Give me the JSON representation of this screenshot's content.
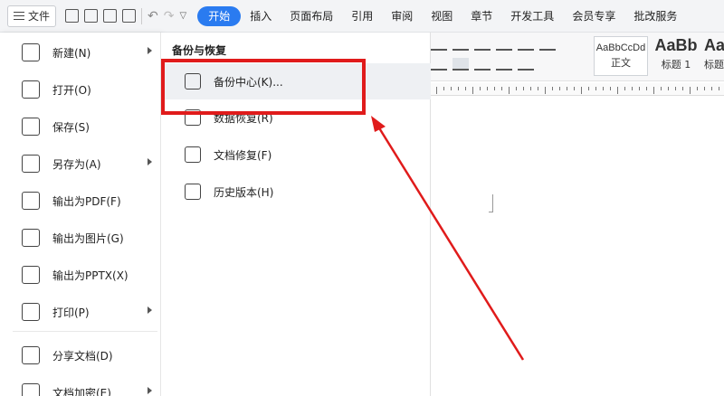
{
  "topbar": {
    "menu_label": "文件",
    "tabs": [
      "开始",
      "插入",
      "页面布局",
      "引用",
      "审阅",
      "视图",
      "章节",
      "开发工具",
      "会员专享",
      "批改服务"
    ],
    "active_tab": "开始"
  },
  "ribbon": {
    "styles": [
      {
        "sample": "AaBbCcDd",
        "label": "正文"
      },
      {
        "sample": "AaBb",
        "label": "标题 1"
      },
      {
        "sample": "AaE",
        "label": "标题"
      }
    ]
  },
  "file_menu": {
    "items": [
      {
        "label": "新建(N)",
        "icon": "new-doc-icon",
        "arrow": true
      },
      {
        "label": "打开(O)",
        "icon": "folder-open-icon",
        "arrow": false
      },
      {
        "label": "保存(S)",
        "icon": "save-icon",
        "arrow": false
      },
      {
        "label": "另存为(A)",
        "icon": "save-as-icon",
        "arrow": true
      },
      {
        "label": "输出为PDF(F)",
        "icon": "pdf-icon",
        "arrow": false
      },
      {
        "label": "输出为图片(G)",
        "icon": "image-icon",
        "arrow": false
      },
      {
        "label": "输出为PPTX(X)",
        "icon": "pptx-icon",
        "arrow": false
      },
      {
        "label": "打印(P)",
        "icon": "print-icon",
        "arrow": true
      },
      {
        "label": "分享文档(D)",
        "icon": "share-icon",
        "arrow": false
      },
      {
        "label": "文档加密(E)",
        "icon": "encrypt-icon",
        "arrow": true
      }
    ]
  },
  "submenu": {
    "title": "备份与恢复",
    "items": [
      {
        "label": "备份中心(K)...",
        "icon": "backup-center-icon"
      },
      {
        "label": "数据恢复(R)",
        "icon": "data-recovery-icon"
      },
      {
        "label": "文档修复(F)",
        "icon": "doc-repair-icon"
      },
      {
        "label": "历史版本(H)",
        "icon": "history-icon"
      }
    ]
  },
  "colors": {
    "accent": "#2a7bf0",
    "annotation_red": "#e01b1b"
  }
}
